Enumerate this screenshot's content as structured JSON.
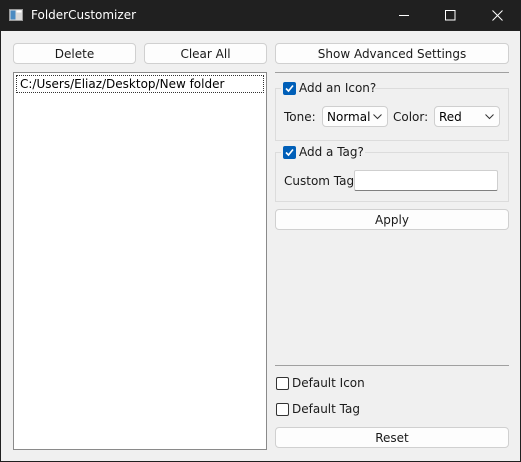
{
  "window": {
    "title": "FolderCustomizer",
    "app_icon": "folder-app-icon"
  },
  "titlebar_controls": {
    "minimize": "minimize-icon",
    "maximize": "maximize-icon",
    "close": "close-icon"
  },
  "toolbar": {
    "delete_label": "Delete",
    "clear_all_label": "Clear All",
    "advanced_label": "Show Advanced Settings"
  },
  "folder_list": {
    "items": [
      "C:/Users/Eliaz/Desktop/New folder"
    ]
  },
  "icon_group": {
    "checkbox_label": "Add an Icon?",
    "checked": true,
    "tone_label": "Tone:",
    "tone_value": "Normal",
    "color_label": "Color:",
    "color_value": "Red"
  },
  "tag_group": {
    "checkbox_label": "Add a Tag?",
    "checked": true,
    "custom_tag_label": "Custom Tag",
    "custom_tag_value": ""
  },
  "apply_label": "Apply",
  "defaults": {
    "default_icon_label": "Default Icon",
    "default_icon_checked": false,
    "default_tag_label": "Default Tag",
    "default_tag_checked": false
  },
  "reset_label": "Reset",
  "colors": {
    "accent": "#005fb8",
    "titlebar": "#202020",
    "client": "#f0f0f0"
  }
}
